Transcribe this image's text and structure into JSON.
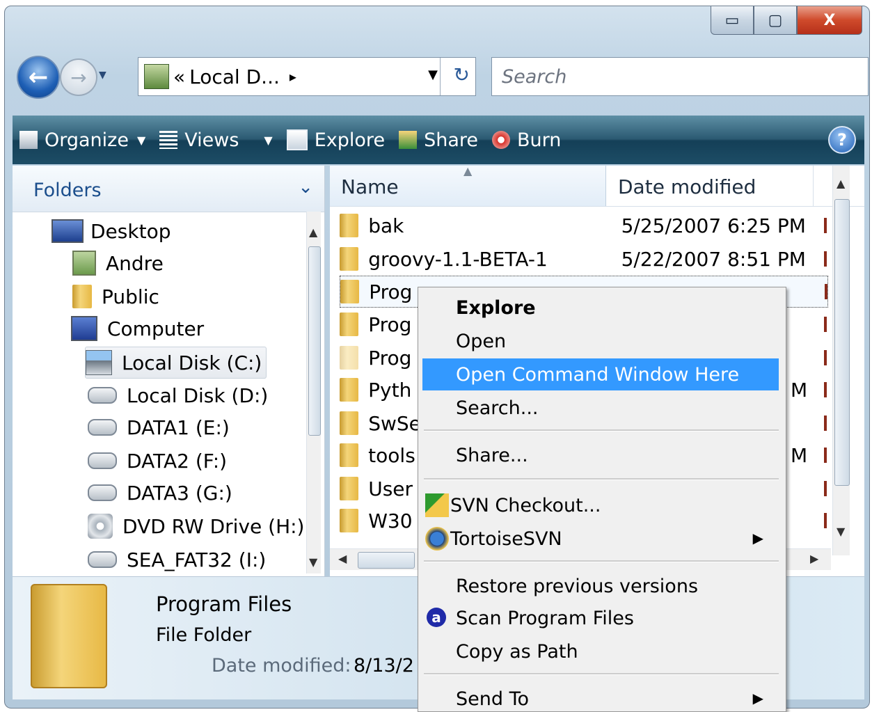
{
  "window": {
    "minimize_glyph": "▭",
    "maximize_glyph": "▢",
    "close_glyph": "X"
  },
  "nav": {
    "back_glyph": "←",
    "forward_glyph": "→",
    "history_glyph": "▼"
  },
  "address": {
    "chevrons": "«",
    "path": "Local D...",
    "arrow": "▸",
    "dropdown": "▼",
    "refresh_glyph": "↻"
  },
  "search": {
    "placeholder": "Search"
  },
  "toolbar": {
    "organize": "Organize",
    "views": "Views",
    "explore": "Explore",
    "share": "Share",
    "burn": "Burn",
    "organize_dd": "▼",
    "views_dd": "▼",
    "help": "?"
  },
  "folders": {
    "title": "Folders",
    "chevron": "⌄",
    "items": [
      "Desktop",
      "Andre",
      "Public",
      "Computer",
      "Local Disk (C:)",
      "Local Disk (D:)",
      "DATA1 (E:)",
      "DATA2 (F:)",
      "DATA3 (G:)",
      "DVD RW Drive (H:)",
      "SEA_FAT32 (I:)"
    ]
  },
  "columns": {
    "name": "Name",
    "date": "Date modified",
    "sort_glyph": "▲"
  },
  "files": [
    {
      "name": "bak",
      "date": "5/25/2007 6:25 PM"
    },
    {
      "name": "groovy-1.1-BETA-1",
      "date": "5/22/2007 8:51 PM"
    },
    {
      "name": "Prog",
      "date": ""
    },
    {
      "name": "Prog",
      "date": ""
    },
    {
      "name": "Prog",
      "date": ""
    },
    {
      "name": "Pyth",
      "date": "M"
    },
    {
      "name": "SwSe",
      "date": ""
    },
    {
      "name": "tools",
      "date": "M"
    },
    {
      "name": "User",
      "date": ""
    },
    {
      "name": "W30",
      "date": ""
    }
  ],
  "details": {
    "name": "Program Files",
    "type": "File Folder",
    "date_label": "Date modified:",
    "date_value": "8/13/2"
  },
  "context_menu": {
    "explore": "Explore",
    "open": "Open",
    "open_cmd": "Open Command Window Here",
    "search": "Search...",
    "share": "Share...",
    "svn_checkout": "SVN Checkout...",
    "tortoise": "TortoiseSVN",
    "restore": "Restore previous versions",
    "scan": "Scan Program Files",
    "copy_path": "Copy as Path",
    "send_to": "Send To",
    "submenu_glyph": "▶"
  },
  "colors": {
    "highlight": "#3399ff",
    "toolbar": "#1d4d66",
    "link": "#1b4e8c"
  }
}
